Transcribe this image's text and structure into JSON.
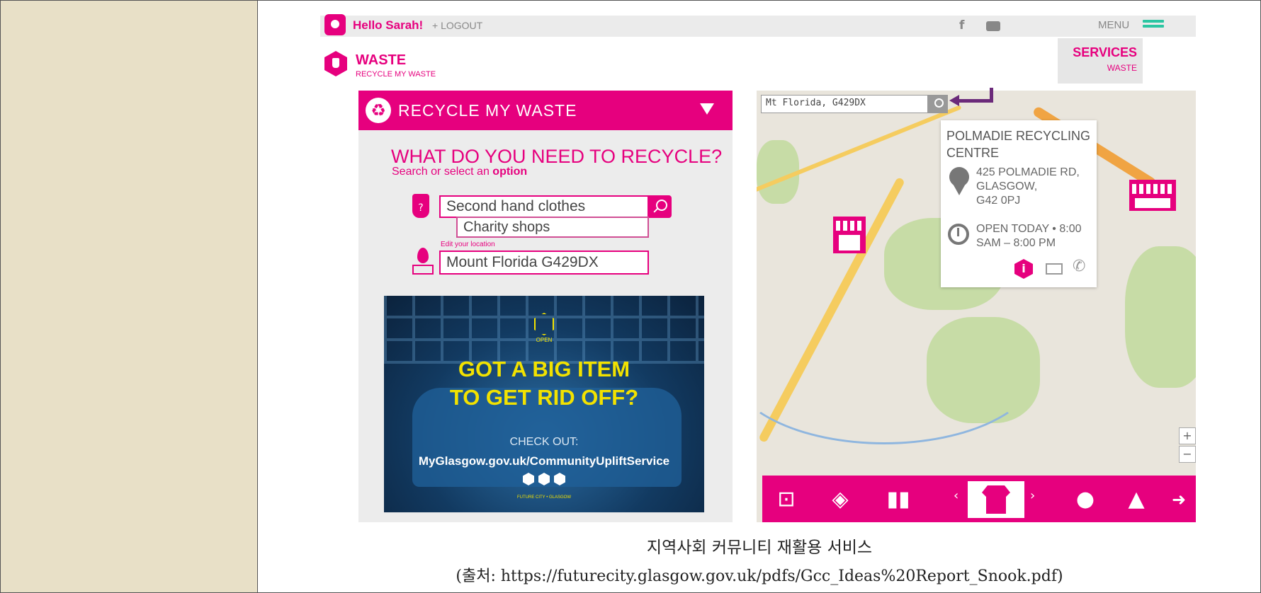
{
  "header": {
    "greeting": "Hello Sarah!",
    "logout": "+ LOGOUT",
    "menu": "MENU"
  },
  "section": {
    "title": "WASTE",
    "subtitle": "RECYCLE MY WASTE"
  },
  "services": {
    "title": "SERVICES",
    "sub": "WASTE"
  },
  "recycle_panel": {
    "bar_label": "RECYCLE MY WASTE",
    "question": "WHAT DO YOU NEED TO RECYCLE?",
    "hint_prefix": "Search or select an ",
    "hint_bold": "option",
    "search_value": "Second hand clothes",
    "suggestion": "Charity shops",
    "edit_location_label": "Edit your location",
    "location_value": "Mount Florida G429DX"
  },
  "ad": {
    "badge": "OPEN",
    "headline_1": "GOT A BIG ITEM",
    "headline_2": "TO GET RID OFF?",
    "check_out": "CHECK OUT:",
    "url": "MyGlasgow.gov.uk/CommunityUpliftService",
    "footer": "FUTURE CITY • GLASGOW"
  },
  "map": {
    "search_value": "Mt Florida, G429DX",
    "popup": {
      "title": "POLMADIE RECYCLING CENTRE",
      "address_1": "425 POLMADIE RD,",
      "address_2": "GLASGOW,",
      "address_3": "G42 0PJ",
      "hours_1": "OPEN TODAY • 8:00",
      "hours_2": "SAM – 8:00 PM"
    },
    "zoom_in": "+",
    "zoom_out": "−"
  },
  "categories": [
    "washing-machine-icon",
    "layers-icon",
    "bottles-icon",
    "tshirt-icon",
    "apple-icon",
    "flask-icon"
  ],
  "caption": {
    "title": "지역사회 커뮤니티 재활용 서비스",
    "source": "(출처: https://futurecity.glasgow.gov.uk/pdfs/Gcc_Ideas%20Report_Snook.pdf)"
  },
  "colors": {
    "brand": "#e6007e",
    "menu_accent": "#2bc6a2",
    "sidebar": "#e8e0c7"
  }
}
